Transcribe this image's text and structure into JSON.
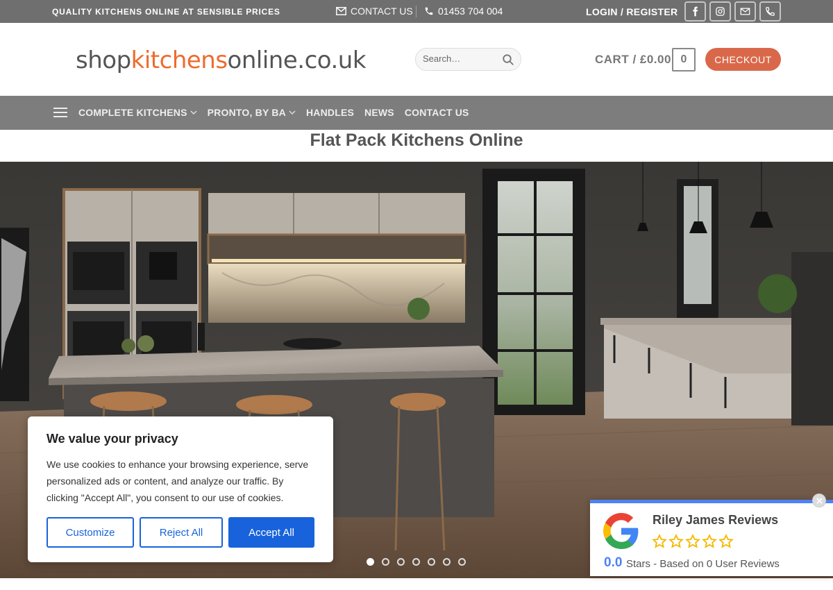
{
  "topbar": {
    "tagline": "QUALITY KITCHENS ONLINE AT SENSIBLE PRICES",
    "contact_label": "CONTACT US",
    "phone": "01453 704 004",
    "login_label": "LOGIN / REGISTER",
    "socials": [
      "facebook-icon",
      "instagram-icon",
      "envelope-icon",
      "phone-icon"
    ]
  },
  "header": {
    "logo_pre": "shop",
    "logo_highlight": "kitchens",
    "logo_post": "online.co.uk",
    "search_placeholder": "Search…",
    "cart_label": "CART / £0.00",
    "cart_count": "0",
    "checkout_label": "CHECKOUT"
  },
  "nav": {
    "items": [
      {
        "label": "COMPLETE KITCHENS",
        "dropdown": true
      },
      {
        "label": "PRONTO, BY BA",
        "dropdown": true
      },
      {
        "label": "HANDLES",
        "dropdown": false
      },
      {
        "label": "NEWS",
        "dropdown": false
      },
      {
        "label": "CONTACT US",
        "dropdown": false
      }
    ]
  },
  "page": {
    "title": "Flat Pack Kitchens Online"
  },
  "slider": {
    "slide_count": 7,
    "active_index": 0
  },
  "cookie": {
    "title": "We value your privacy",
    "text": "We use cookies to enhance your browsing experience, serve personalized ads or content, and analyze our traffic. By clicking \"Accept All\", you consent to our use of cookies.",
    "customize_label": "Customize",
    "reject_label": "Reject All",
    "accept_label": "Accept All"
  },
  "reviews": {
    "name": "Riley James Reviews",
    "score": "0.0",
    "summary": "Stars - Based on 0 User Reviews",
    "stars_filled": 0,
    "stars_total": 5
  },
  "colors": {
    "accent": "#ef6b2e",
    "checkout": "#d9684a",
    "cookie_blue": "#1863dc",
    "review_blue": "#4e81f5"
  }
}
